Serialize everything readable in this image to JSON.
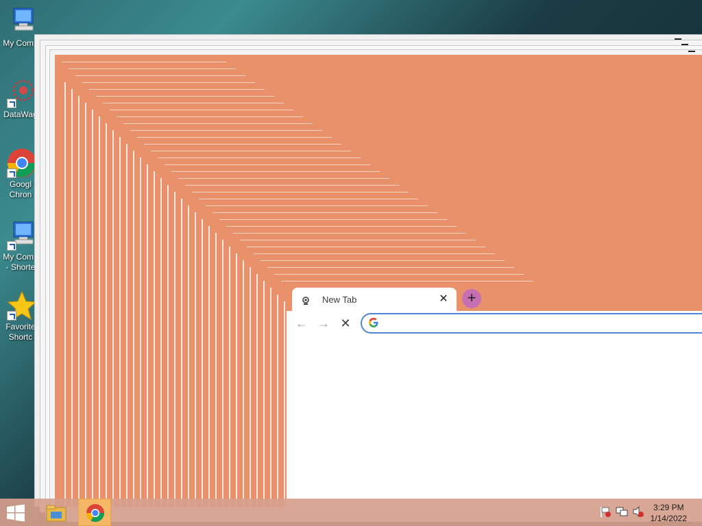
{
  "desktop": {
    "icons": [
      {
        "label": "My Comp",
        "icon": "computer-icon"
      },
      {
        "label": "DataWag",
        "icon": "datawagon-icon"
      },
      {
        "label": "Googl\nChron",
        "icon": "chrome-icon"
      },
      {
        "label": "My Comp\n- Shorte",
        "icon": "computer-icon"
      },
      {
        "label": "Favorite\nShortc",
        "icon": "star-icon"
      }
    ]
  },
  "browser": {
    "tab_title": "New Tab",
    "tab_close": "✕",
    "new_tab_symbol": "+",
    "back_symbol": "←",
    "forward_symbol": "→",
    "stop_symbol": "✕",
    "address_value": "",
    "accent": "#4d86d6",
    "frame_color": "#e8916b"
  },
  "taskbar": {
    "pinned": [
      "file-explorer-icon",
      "chrome-icon"
    ],
    "tray": [
      "action-center-flag-icon",
      "network-icon",
      "volume-muted-icon"
    ],
    "time": "3:29 PM",
    "date": "1/14/2022"
  }
}
